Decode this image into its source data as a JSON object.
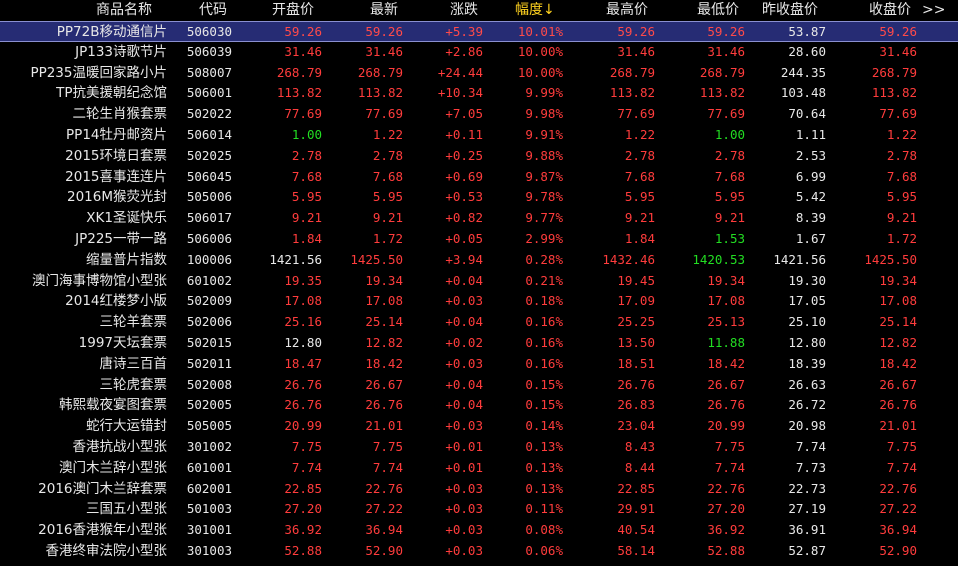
{
  "header": {
    "name": "商品名称",
    "code": "代码",
    "open": "开盘价",
    "latest": "最新",
    "change": "涨跌",
    "pct": "幅度↓",
    "high": "最高价",
    "low": "最低价",
    "prev": "昨收盘价",
    "close": "收盘价",
    "more": ">>"
  },
  "colors": {
    "up": "#ff3c3c",
    "down": "#22dd22",
    "flat": "#e8e8e8",
    "sort_header": "#ffd21f",
    "selected_row": "#262C74"
  },
  "rows": [
    {
      "name": "PP72B移动通信片",
      "code": "506030",
      "open": "59.26",
      "latest": "59.26",
      "change": "+5.39",
      "pct": "10.01%",
      "high": "59.26",
      "low": "59.26",
      "prev": "53.87",
      "close": "59.26",
      "c": {
        "open": "r",
        "latest": "r",
        "high": "r",
        "low": "r",
        "close": "r"
      }
    },
    {
      "name": "JP133诗歌节片",
      "code": "506039",
      "open": "31.46",
      "latest": "31.46",
      "change": "+2.86",
      "pct": "10.00%",
      "high": "31.46",
      "low": "31.46",
      "prev": "28.60",
      "close": "31.46",
      "c": {
        "open": "r",
        "latest": "r",
        "high": "r",
        "low": "r",
        "close": "r"
      }
    },
    {
      "name": "PP235温暖回家路小片",
      "code": "508007",
      "open": "268.79",
      "latest": "268.79",
      "change": "+24.44",
      "pct": "10.00%",
      "high": "268.79",
      "low": "268.79",
      "prev": "244.35",
      "close": "268.79",
      "c": {
        "open": "r",
        "latest": "r",
        "high": "r",
        "low": "r",
        "close": "r"
      }
    },
    {
      "name": "TP抗美援朝纪念馆",
      "code": "506001",
      "open": "113.82",
      "latest": "113.82",
      "change": "+10.34",
      "pct": "9.99%",
      "high": "113.82",
      "low": "113.82",
      "prev": "103.48",
      "close": "113.82",
      "c": {
        "open": "r",
        "latest": "r",
        "high": "r",
        "low": "r",
        "close": "r"
      }
    },
    {
      "name": "二轮生肖猴套票",
      "code": "502022",
      "open": "77.69",
      "latest": "77.69",
      "change": "+7.05",
      "pct": "9.98%",
      "high": "77.69",
      "low": "77.69",
      "prev": "70.64",
      "close": "77.69",
      "c": {
        "open": "r",
        "latest": "r",
        "high": "r",
        "low": "r",
        "close": "r"
      }
    },
    {
      "name": "PP14牡丹邮资片",
      "code": "506014",
      "open": "1.00",
      "latest": "1.22",
      "change": "+0.11",
      "pct": "9.91%",
      "high": "1.22",
      "low": "1.00",
      "prev": "1.11",
      "close": "1.22",
      "c": {
        "open": "g",
        "latest": "r",
        "high": "r",
        "low": "g",
        "close": "r"
      }
    },
    {
      "name": "2015环境日套票",
      "code": "502025",
      "open": "2.78",
      "latest": "2.78",
      "change": "+0.25",
      "pct": "9.88%",
      "high": "2.78",
      "low": "2.78",
      "prev": "2.53",
      "close": "2.78",
      "c": {
        "open": "r",
        "latest": "r",
        "high": "r",
        "low": "r",
        "close": "r"
      }
    },
    {
      "name": "2015喜事连连片",
      "code": "506045",
      "open": "7.68",
      "latest": "7.68",
      "change": "+0.69",
      "pct": "9.87%",
      "high": "7.68",
      "low": "7.68",
      "prev": "6.99",
      "close": "7.68",
      "c": {
        "open": "r",
        "latest": "r",
        "high": "r",
        "low": "r",
        "close": "r"
      }
    },
    {
      "name": "2016M猴荧光封",
      "code": "505006",
      "open": "5.95",
      "latest": "5.95",
      "change": "+0.53",
      "pct": "9.78%",
      "high": "5.95",
      "low": "5.95",
      "prev": "5.42",
      "close": "5.95",
      "c": {
        "open": "r",
        "latest": "r",
        "high": "r",
        "low": "r",
        "close": "r"
      }
    },
    {
      "name": "XK1圣诞快乐",
      "code": "506017",
      "open": "9.21",
      "latest": "9.21",
      "change": "+0.82",
      "pct": "9.77%",
      "high": "9.21",
      "low": "9.21",
      "prev": "8.39",
      "close": "9.21",
      "c": {
        "open": "r",
        "latest": "r",
        "high": "r",
        "low": "r",
        "close": "r"
      }
    },
    {
      "name": "JP225一带一路",
      "code": "506006",
      "open": "1.84",
      "latest": "1.72",
      "change": "+0.05",
      "pct": "2.99%",
      "high": "1.84",
      "low": "1.53",
      "prev": "1.67",
      "close": "1.72",
      "c": {
        "open": "r",
        "latest": "r",
        "high": "r",
        "low": "g",
        "close": "r"
      }
    },
    {
      "name": "缩量普片指数",
      "code": "100006",
      "open": "1421.56",
      "latest": "1425.50",
      "change": "+3.94",
      "pct": "0.28%",
      "high": "1432.46",
      "low": "1420.53",
      "prev": "1421.56",
      "close": "1425.50",
      "c": {
        "open": "w",
        "latest": "r",
        "high": "r",
        "low": "g",
        "close": "r"
      }
    },
    {
      "name": "澳门海事博物馆小型张",
      "code": "601002",
      "open": "19.35",
      "latest": "19.34",
      "change": "+0.04",
      "pct": "0.21%",
      "high": "19.45",
      "low": "19.34",
      "prev": "19.30",
      "close": "19.34",
      "c": {
        "open": "r",
        "latest": "r",
        "high": "r",
        "low": "r",
        "close": "r"
      }
    },
    {
      "name": "2014红楼梦小版",
      "code": "502009",
      "open": "17.08",
      "latest": "17.08",
      "change": "+0.03",
      "pct": "0.18%",
      "high": "17.09",
      "low": "17.08",
      "prev": "17.05",
      "close": "17.08",
      "c": {
        "open": "r",
        "latest": "r",
        "high": "r",
        "low": "r",
        "close": "r"
      }
    },
    {
      "name": "三轮羊套票",
      "code": "502006",
      "open": "25.16",
      "latest": "25.14",
      "change": "+0.04",
      "pct": "0.16%",
      "high": "25.25",
      "low": "25.13",
      "prev": "25.10",
      "close": "25.14",
      "c": {
        "open": "r",
        "latest": "r",
        "high": "r",
        "low": "r",
        "close": "r"
      }
    },
    {
      "name": "1997天坛套票",
      "code": "502015",
      "open": "12.80",
      "latest": "12.82",
      "change": "+0.02",
      "pct": "0.16%",
      "high": "13.50",
      "low": "11.88",
      "prev": "12.80",
      "close": "12.82",
      "c": {
        "open": "w",
        "latest": "r",
        "high": "r",
        "low": "g",
        "close": "r"
      }
    },
    {
      "name": "唐诗三百首",
      "code": "502011",
      "open": "18.47",
      "latest": "18.42",
      "change": "+0.03",
      "pct": "0.16%",
      "high": "18.51",
      "low": "18.42",
      "prev": "18.39",
      "close": "18.42",
      "c": {
        "open": "r",
        "latest": "r",
        "high": "r",
        "low": "r",
        "close": "r"
      }
    },
    {
      "name": "三轮虎套票",
      "code": "502008",
      "open": "26.76",
      "latest": "26.67",
      "change": "+0.04",
      "pct": "0.15%",
      "high": "26.76",
      "low": "26.67",
      "prev": "26.63",
      "close": "26.67",
      "c": {
        "open": "r",
        "latest": "r",
        "high": "r",
        "low": "r",
        "close": "r"
      }
    },
    {
      "name": "韩熙载夜宴图套票",
      "code": "502005",
      "open": "26.76",
      "latest": "26.76",
      "change": "+0.04",
      "pct": "0.15%",
      "high": "26.83",
      "low": "26.76",
      "prev": "26.72",
      "close": "26.76",
      "c": {
        "open": "r",
        "latest": "r",
        "high": "r",
        "low": "r",
        "close": "r"
      }
    },
    {
      "name": "蛇行大运错封",
      "code": "505005",
      "open": "20.99",
      "latest": "21.01",
      "change": "+0.03",
      "pct": "0.14%",
      "high": "23.04",
      "low": "20.99",
      "prev": "20.98",
      "close": "21.01",
      "c": {
        "open": "r",
        "latest": "r",
        "high": "r",
        "low": "r",
        "close": "r"
      }
    },
    {
      "name": "香港抗战小型张",
      "code": "301002",
      "open": "7.75",
      "latest": "7.75",
      "change": "+0.01",
      "pct": "0.13%",
      "high": "8.43",
      "low": "7.75",
      "prev": "7.74",
      "close": "7.75",
      "c": {
        "open": "r",
        "latest": "r",
        "high": "r",
        "low": "r",
        "close": "r"
      }
    },
    {
      "name": "澳门木兰辞小型张",
      "code": "601001",
      "open": "7.74",
      "latest": "7.74",
      "change": "+0.01",
      "pct": "0.13%",
      "high": "8.44",
      "low": "7.74",
      "prev": "7.73",
      "close": "7.74",
      "c": {
        "open": "r",
        "latest": "r",
        "high": "r",
        "low": "r",
        "close": "r"
      }
    },
    {
      "name": "2016澳门木兰辞套票",
      "code": "602001",
      "open": "22.85",
      "latest": "22.76",
      "change": "+0.03",
      "pct": "0.13%",
      "high": "22.85",
      "low": "22.76",
      "prev": "22.73",
      "close": "22.76",
      "c": {
        "open": "r",
        "latest": "r",
        "high": "r",
        "low": "r",
        "close": "r"
      }
    },
    {
      "name": "三国五小型张",
      "code": "501003",
      "open": "27.20",
      "latest": "27.22",
      "change": "+0.03",
      "pct": "0.11%",
      "high": "29.91",
      "low": "27.20",
      "prev": "27.19",
      "close": "27.22",
      "c": {
        "open": "r",
        "latest": "r",
        "high": "r",
        "low": "r",
        "close": "r"
      }
    },
    {
      "name": "2016香港猴年小型张",
      "code": "301001",
      "open": "36.92",
      "latest": "36.94",
      "change": "+0.03",
      "pct": "0.08%",
      "high": "40.54",
      "low": "36.92",
      "prev": "36.91",
      "close": "36.94",
      "c": {
        "open": "r",
        "latest": "r",
        "high": "r",
        "low": "r",
        "close": "r"
      }
    },
    {
      "name": "香港终审法院小型张",
      "code": "301003",
      "open": "52.88",
      "latest": "52.90",
      "change": "+0.03",
      "pct": "0.06%",
      "high": "58.14",
      "low": "52.88",
      "prev": "52.87",
      "close": "52.90",
      "c": {
        "open": "r",
        "latest": "r",
        "high": "r",
        "low": "r",
        "close": "r"
      }
    }
  ]
}
